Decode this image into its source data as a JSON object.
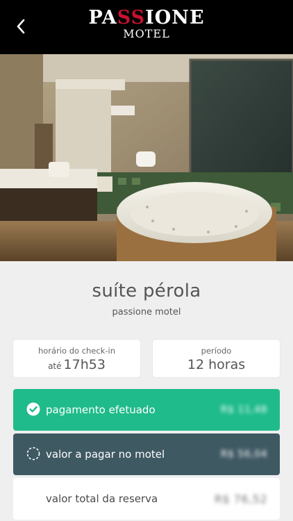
{
  "header": {
    "logo_line1_a": "PA",
    "logo_line1_ss": "SS",
    "logo_line1_b": "IONE",
    "logo_line2": "MOTEL"
  },
  "suite": {
    "name": "suíte pérola",
    "motel": "passione motel"
  },
  "checkin": {
    "label": "horário do check-in",
    "prefix": "até",
    "time": "17h53"
  },
  "period": {
    "label": "período",
    "value": "12 horas"
  },
  "payment": {
    "paid_label": "pagamento efetuado",
    "paid_amount": "R$ 11,48",
    "due_label": "valor a pagar no motel",
    "due_amount": "R$ 56,04",
    "total_label": "valor total da reserva",
    "total_amount": "R$ 76,52"
  },
  "colors": {
    "header_bg": "#000000",
    "paid_bg": "#1fbb8a",
    "due_bg": "#3f5963",
    "brand_accent": "#c4122f"
  }
}
